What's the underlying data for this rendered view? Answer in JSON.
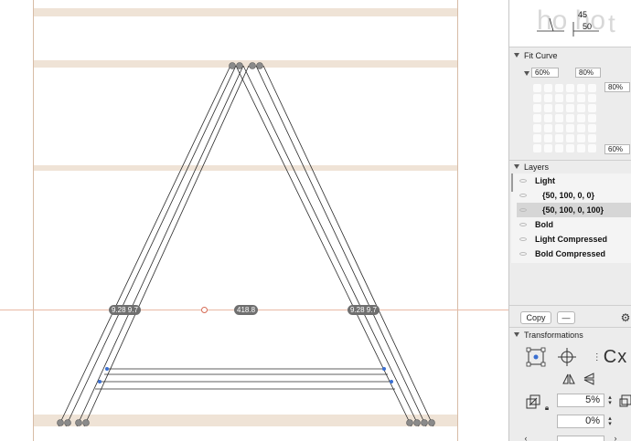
{
  "canvas": {
    "measure_left": "9.28 9.7",
    "measure_center": "418.8",
    "measure_right": "9.28 9.7"
  },
  "preview": {
    "value_top": "45",
    "value_bottom": "50",
    "ghost_text": "ho ho",
    "ghost_glyph": "t"
  },
  "fit_curve": {
    "title": "Fit Curve",
    "left_value": "60%",
    "top_value": "80%",
    "right_top_value": "80%",
    "right_bottom_value": "60%"
  },
  "layers": {
    "title": "Layers",
    "items": [
      {
        "label": "Light",
        "selected": false,
        "indent": false
      },
      {
        "label": "{50, 100, 0, 0}",
        "selected": false,
        "indent": true
      },
      {
        "label": "{50, 100, 0, 100}",
        "selected": true,
        "indent": true
      },
      {
        "label": "Bold",
        "selected": false,
        "indent": false
      },
      {
        "label": "Light Compressed",
        "selected": false,
        "indent": false
      },
      {
        "label": "Bold Compressed",
        "selected": false,
        "indent": false
      }
    ]
  },
  "toolbar": {
    "copy_label": "Copy",
    "minus_label": "—"
  },
  "transformations": {
    "title": "Transformations",
    "scale_value": "5%",
    "slant_value": "0%",
    "cx_label": "Cx"
  },
  "colors": {
    "guide": "#efe3d6",
    "selection": "#d66b55",
    "accent_blue": "#3a6fd1"
  }
}
